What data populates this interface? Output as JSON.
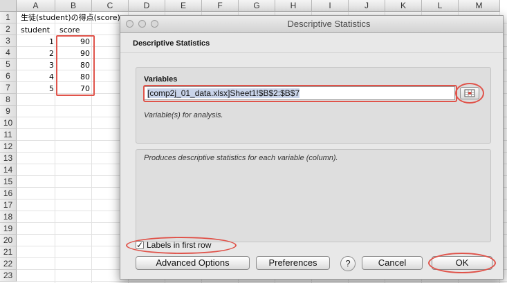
{
  "sheet": {
    "columns": [
      "A",
      "B",
      "C",
      "D",
      "E",
      "F",
      "G",
      "H",
      "I",
      "J",
      "K",
      "L",
      "M"
    ],
    "rows": [
      "1",
      "2",
      "3",
      "4",
      "5",
      "6",
      "7",
      "8",
      "9",
      "10",
      "11",
      "12",
      "13",
      "14",
      "15",
      "16",
      "17",
      "18",
      "19",
      "20",
      "21",
      "22",
      "23"
    ],
    "a1": "生徒(student)の得点(score)",
    "a2": "student",
    "b2": "score",
    "data": [
      {
        "student": "1",
        "score": "90"
      },
      {
        "student": "2",
        "score": "90"
      },
      {
        "student": "3",
        "score": "80"
      },
      {
        "student": "4",
        "score": "80"
      },
      {
        "student": "5",
        "score": "70"
      }
    ]
  },
  "dialog": {
    "window_title": "Descriptive Statistics",
    "heading": "Descriptive Statistics",
    "variables_label": "Variables",
    "variables_value": "[comp2j_01_data.xlsx]Sheet1!$B$2:$B$7",
    "variables_help": "Variable(s) for analysis.",
    "description": "Produces descriptive statistics for each variable (column).",
    "labels_checkbox": "Labels in first row",
    "labels_checked": true,
    "buttons": {
      "advanced": "Advanced Options",
      "preferences": "Preferences",
      "help": "?",
      "cancel": "Cancel",
      "ok": "OK"
    }
  },
  "colors": {
    "highlight": "#e0534a",
    "selection": "#c9d4ea"
  }
}
